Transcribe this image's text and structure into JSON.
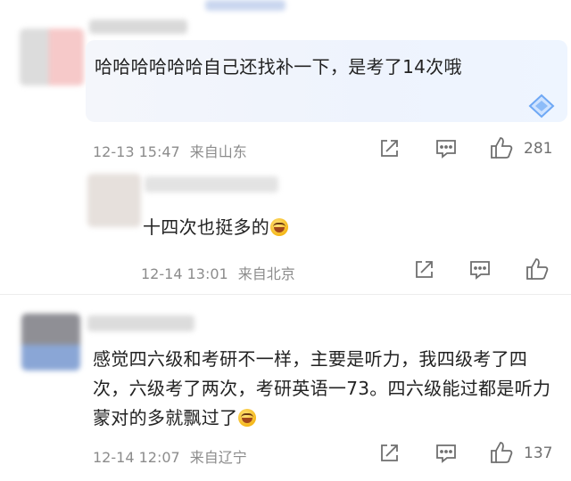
{
  "comments": [
    {
      "text": "哈哈哈哈哈哈自己还找补一下，是考了14次哦",
      "date": "12-13 15:47",
      "location": "来自山东",
      "likes": "281"
    },
    {
      "text": "十四次也挺多的",
      "date": "12-14 13:01",
      "location": "来自北京",
      "likes": ""
    },
    {
      "text": "感觉四六级和考研不一样，主要是听力，我四级考了四次，六级考了两次，考研英语一73。四六级能过都是听力蒙对的多就飘过了",
      "date": "12-14 12:07",
      "location": "来自辽宁",
      "likes": "137"
    }
  ],
  "icons": [
    "share-icon",
    "reply-icon",
    "like-icon",
    "laugh-emoji-icon",
    "diamond-badge-icon"
  ],
  "colors": {
    "text": "#222222",
    "meta": "#8c8c8c",
    "icon": "#6f6f6f"
  }
}
